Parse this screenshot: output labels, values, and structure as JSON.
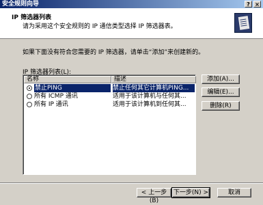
{
  "window": {
    "title": "安全规则向导",
    "help_btn": "?",
    "close_btn": "×"
  },
  "header": {
    "title": "IP 筛选器列表",
    "subtitle": "请为采用这个安全规则的 IP 通信类型选择 IP 筛选器表。",
    "icon": "wizard-page-icon"
  },
  "hint": "如果下面没有符合您需要的 IP 筛选器，请单击“添加”来创建新的。",
  "list": {
    "label": "IP 筛选器列表(L):",
    "columns": [
      "名称",
      "描述"
    ],
    "rows": [
      {
        "name": "禁止PING",
        "desc": "禁止任何其它计算机PING...",
        "selected": true
      },
      {
        "name": "所有 ICMP 通讯",
        "desc": "适用于该计算机与任何其...",
        "selected": false
      },
      {
        "name": "所有 IP 通讯",
        "desc": "适用于该计算机到任何其...",
        "selected": false
      }
    ]
  },
  "side_buttons": {
    "add": "添加(A)...",
    "edit": "编辑(E)...",
    "remove": "删除(R)"
  },
  "footer": {
    "back": "< 上一步(B)",
    "next": "下一步(N) >",
    "cancel": "取消"
  }
}
